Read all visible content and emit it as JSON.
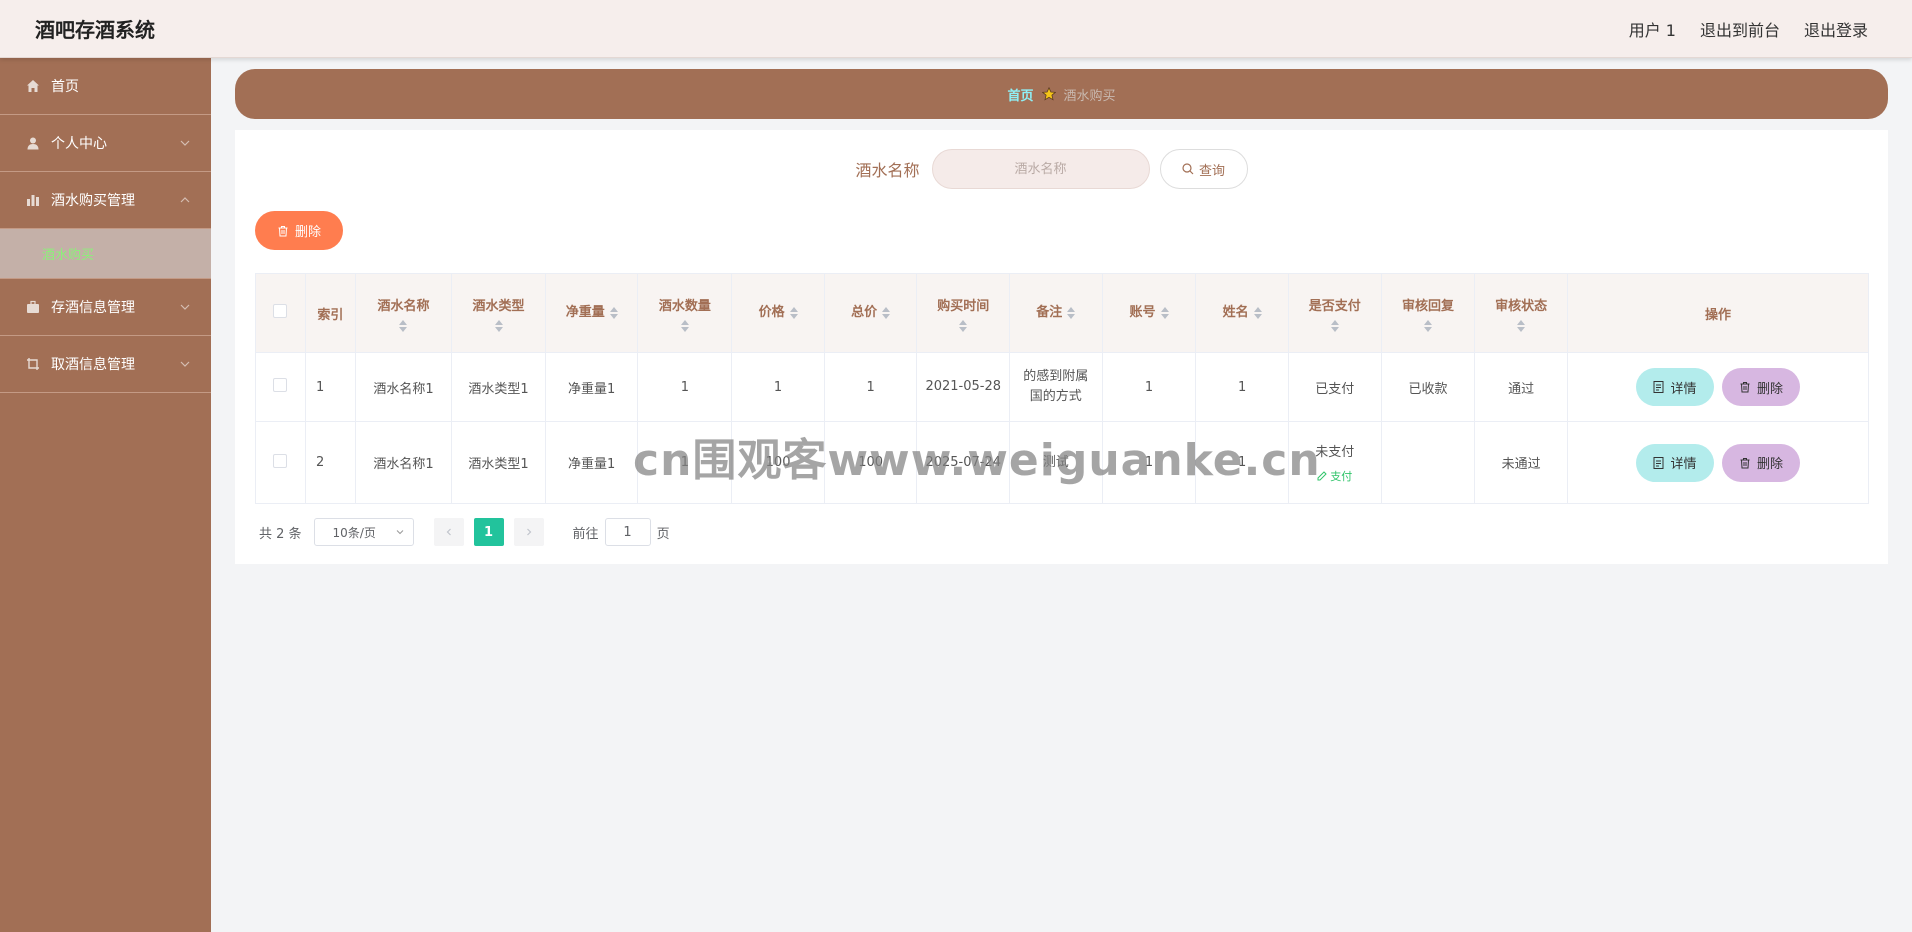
{
  "header": {
    "title": "酒吧存酒系统",
    "links": [
      "用户 1",
      "退出到前台",
      "退出登录"
    ]
  },
  "sidebar": {
    "items": [
      {
        "label": "首页",
        "icon": "home-icon"
      },
      {
        "label": "个人中心",
        "icon": "user-icon"
      },
      {
        "label": "酒水购买管理",
        "icon": "chart-icon"
      },
      {
        "label": "存酒信息管理",
        "icon": "briefcase-icon"
      },
      {
        "label": "取酒信息管理",
        "icon": "crop-icon"
      }
    ],
    "submenu_active": "酒水购买"
  },
  "breadcrumb": {
    "home": "首页",
    "current": "酒水购买"
  },
  "search": {
    "label": "酒水名称",
    "placeholder": "酒水名称",
    "button": "查询"
  },
  "toolbar": {
    "delete": "删除"
  },
  "table": {
    "columns": [
      "索引",
      "酒水名称",
      "酒水类型",
      "净重量",
      "酒水数量",
      "价格",
      "总价",
      "购买时间",
      "备注",
      "账号",
      "姓名",
      "是否支付",
      "审核回复",
      "审核状态",
      "操作"
    ],
    "rows": [
      {
        "index": "1",
        "name": "酒水名称1",
        "type": "酒水类型1",
        "weight": "净重量1",
        "qty": "1",
        "price": "1",
        "total": "1",
        "time": "2021-05-28",
        "note": "的感到附属国的方式",
        "account": "1",
        "username": "1",
        "paid": "已支付",
        "reply": "已收款",
        "status": "通过",
        "pay_link": ""
      },
      {
        "index": "2",
        "name": "酒水名称1",
        "type": "酒水类型1",
        "weight": "净重量1",
        "qty": "1",
        "price": "100",
        "total": "100",
        "time": "2025-07-24",
        "note": "测试",
        "account": "1",
        "username": "1",
        "paid": "未支付",
        "reply": "",
        "status": "未通过",
        "pay_link": "支付"
      }
    ],
    "action_detail": "详情",
    "action_delete": "删除"
  },
  "pagination": {
    "total": "共 2 条",
    "page_size": "10条/页",
    "current_page": "1",
    "goto_prefix": "前往",
    "goto_value": "1",
    "goto_suffix": "页"
  },
  "watermark": "cn围观客www.weiguanke.cn",
  "colors": {
    "brand": "#a26f55",
    "header_bg": "#f6eeec",
    "delete_btn": "#ff7d4f",
    "detail_btn": "#b3ecec",
    "delete_row_btn": "#d7b7e1",
    "page_active": "#22c39c",
    "submenu_text": "#8cf07a"
  }
}
